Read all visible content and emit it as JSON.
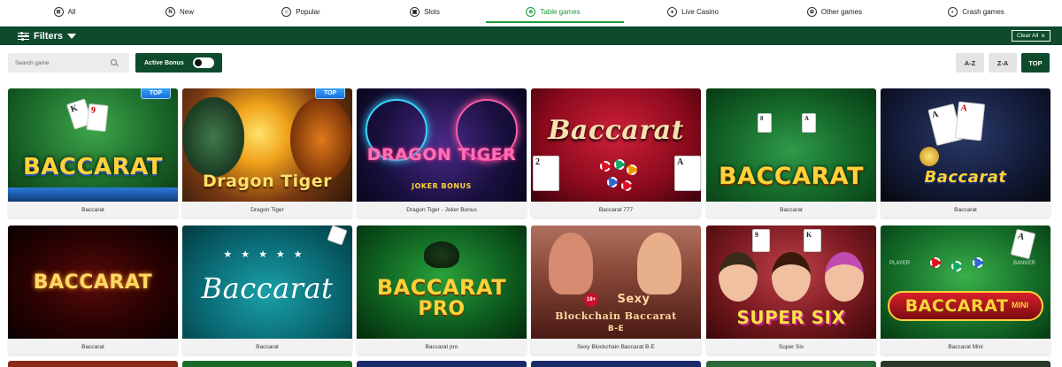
{
  "categories": [
    {
      "label": "All",
      "icon": "grid-circle-icon",
      "glyph": "⊞",
      "active": false
    },
    {
      "label": "New",
      "icon": "new-icon",
      "glyph": "N",
      "active": false
    },
    {
      "label": "Popular",
      "icon": "popular-icon",
      "glyph": "☺",
      "active": false
    },
    {
      "label": "Slots",
      "icon": "slots-icon",
      "glyph": "▣",
      "active": false
    },
    {
      "label": "Table games",
      "icon": "table-games-icon",
      "glyph": "⊕",
      "active": true
    },
    {
      "label": "Live Casino",
      "icon": "live-casino-icon",
      "glyph": "●",
      "active": false
    },
    {
      "label": "Other games",
      "icon": "other-games-icon",
      "glyph": "✿",
      "active": false
    },
    {
      "label": "Crash games",
      "icon": "crash-games-icon",
      "glyph": "◐",
      "active": false
    }
  ],
  "filters": {
    "label": "Filters",
    "clear_all": "Clear All"
  },
  "search": {
    "placeholder": "Search game"
  },
  "active_bonus": {
    "label": "Active Bonus"
  },
  "sort": {
    "az": "A-Z",
    "za": "Z-A",
    "top": "TOP"
  },
  "badge_top": "TOP",
  "games": [
    {
      "name": "Baccarat",
      "thumb_title": "BACCARAT",
      "top": true
    },
    {
      "name": "Dragon Tiger",
      "thumb_title": "Dragon Tiger",
      "top": true
    },
    {
      "name": "Dragon Tiger - Joker Bonus",
      "thumb_title": "DRAGON TIGER",
      "thumb_sub": "JOKER BONUS",
      "top": false
    },
    {
      "name": "Baccarat 777",
      "thumb_title": "Baccarat",
      "top": false
    },
    {
      "name": "Baccarat",
      "thumb_title": "BACCARAT",
      "top": false
    },
    {
      "name": "Baccarat",
      "thumb_title": "Baccarat",
      "top": false
    },
    {
      "name": "Baccarat",
      "thumb_title": "BACCARAT",
      "top": false
    },
    {
      "name": "Baccarat",
      "thumb_title": "Baccarat",
      "top": false
    },
    {
      "name": "Baccarat pro",
      "thumb_title": "BACCARAT",
      "thumb_sub": "PRO",
      "top": false
    },
    {
      "name": "Sexy Blockchain Baccarat B-E",
      "thumb_title": "Sexy",
      "thumb_sub": "Blockchain Baccarat",
      "thumb_sub2": "B-E",
      "thumb_age": "18+",
      "top": false
    },
    {
      "name": "Super Six",
      "thumb_title": "SUPER SIX",
      "top": false
    },
    {
      "name": "Baccarat Mini",
      "thumb_title": "BACCARAT",
      "thumb_sub": "MINI",
      "thumb_player": "PLAYER",
      "thumb_banker": "BANKER",
      "top": false
    }
  ]
}
